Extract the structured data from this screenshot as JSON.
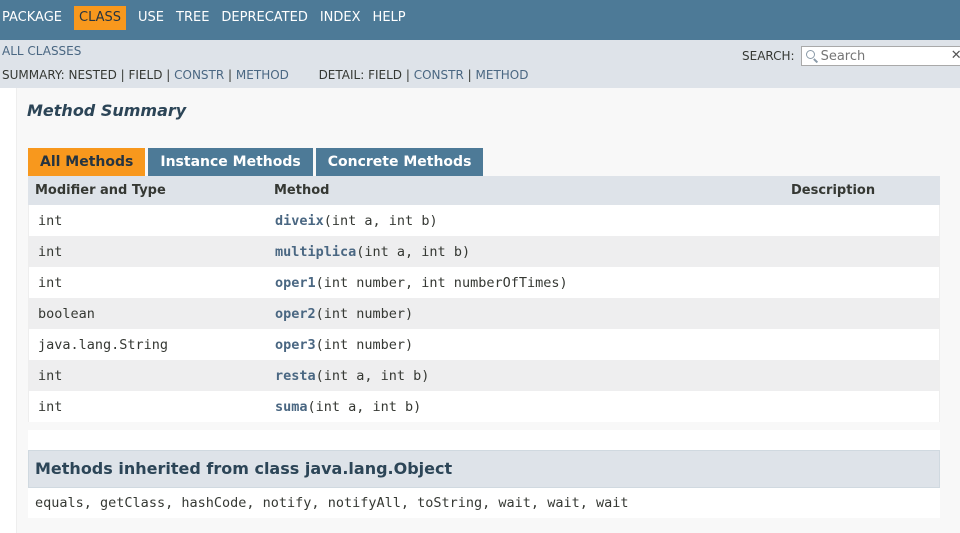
{
  "topnav": {
    "items": [
      "PACKAGE",
      "CLASS",
      "USE",
      "TREE",
      "DEPRECATED",
      "INDEX",
      "HELP"
    ],
    "active": "CLASS"
  },
  "subnav": {
    "all_classes": "ALL CLASSES",
    "search_label": "SEARCH:",
    "search_placeholder": "Search",
    "summary_prefix": "SUMMARY: NESTED | FIELD |",
    "summary_constr": "CONSTR",
    "summary_method": "METHOD",
    "detail_prefix": "DETAIL: FIELD |",
    "detail_constr": "CONSTR",
    "detail_method": "METHOD"
  },
  "method_summary": {
    "title": "Method Summary",
    "tabs": [
      "All Methods",
      "Instance Methods",
      "Concrete Methods"
    ],
    "columns": [
      "Modifier and Type",
      "Method",
      "Description"
    ],
    "rows": [
      {
        "type": "int",
        "name": "diveix",
        "params": "(int a, int b)"
      },
      {
        "type": "int",
        "name": "multiplica",
        "params": "(int a, int b)"
      },
      {
        "type": "int",
        "name": "oper1",
        "params": "(int number, int numberOfTimes)"
      },
      {
        "type": "boolean",
        "name": "oper2",
        "params": "(int number)"
      },
      {
        "type": "java.lang.String",
        "name": "oper3",
        "params": "(int number)"
      },
      {
        "type": "int",
        "name": "resta",
        "params": "(int a, int b)"
      },
      {
        "type": "int",
        "name": "suma",
        "params": "(int a, int b)"
      }
    ]
  },
  "inherited": {
    "title": "Methods inherited from class java.lang.Object",
    "methods": [
      "equals",
      "getClass",
      "hashCode",
      "notify",
      "notifyAll",
      "toString",
      "wait",
      "wait",
      "wait"
    ]
  },
  "colors": {
    "nav_bg": "#4D7A97",
    "accent": "#F8981D",
    "link": "#4A6782",
    "header_bg": "#dee3e9"
  },
  "icons": {
    "search": "magnifier-icon"
  }
}
